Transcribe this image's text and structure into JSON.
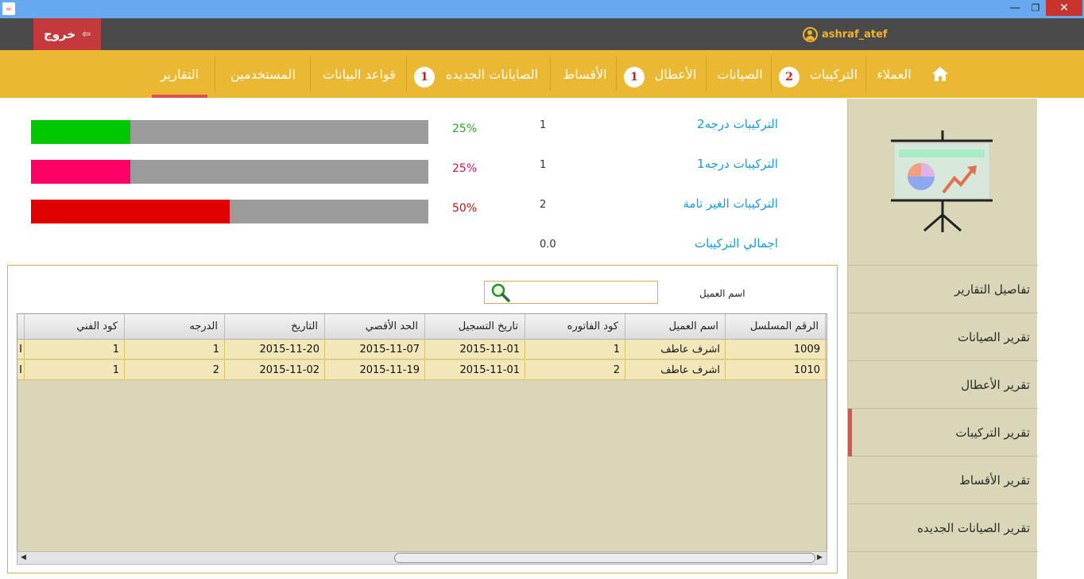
{
  "window": {
    "min_symbol": "—",
    "max_symbol": "❐",
    "close_symbol": "✕",
    "app_icon": "java-icon"
  },
  "header": {
    "logout_label": "خروج",
    "username": "ashraf_atef"
  },
  "nav": {
    "items": [
      {
        "label": "العملاء"
      },
      {
        "label": "التركيبات",
        "badge": "2"
      },
      {
        "label": "الصيانات"
      },
      {
        "label": "الأعطال",
        "badge": "1"
      },
      {
        "label": "الأقساط"
      },
      {
        "label": "الصايانات الجديده",
        "badge": "1"
      },
      {
        "label": "قواعد البيانات"
      },
      {
        "label": "المستخدمين"
      },
      {
        "label": "التقارير"
      }
    ],
    "active": "التقارير"
  },
  "stats": {
    "rows": [
      {
        "label": "التركيبات درجه2",
        "value": "1",
        "percent": "25%",
        "fraction": 0.25,
        "color": "#00c800",
        "pct_color": "#2aa82a"
      },
      {
        "label": "التركيبات درجه1",
        "value": "1",
        "percent": "25%",
        "fraction": 0.25,
        "color": "#ff0066",
        "pct_color": "#d0105a"
      },
      {
        "label": "التركيبات الغير تامة",
        "value": "2",
        "percent": "50%",
        "fraction": 0.5,
        "color": "#e00000",
        "pct_color": "#c01010"
      }
    ],
    "total": {
      "label": "اجمالي التركيبات",
      "value": "0.0"
    }
  },
  "search": {
    "label": "اسم العميل",
    "value": ""
  },
  "table": {
    "columns": [
      "الرقم المسلسل",
      "اسم العميل",
      "كود الفاتوره",
      "تاريخ التسجيل",
      "الحد الأقصي",
      "التاريخ",
      "الدرجه",
      "كود الفني",
      "I"
    ],
    "rows": [
      [
        "1009",
        "اشرف عاطف",
        "1",
        "2015-11-01",
        "2015-11-07",
        "2015-11-20",
        "1",
        "1",
        "I"
      ],
      [
        "1010",
        "اشرف عاطف",
        "2",
        "2015-11-01",
        "2015-11-19",
        "2015-11-02",
        "2",
        "1",
        "I"
      ]
    ]
  },
  "sidebar": {
    "items": [
      {
        "label": "تفاصيل التقارير"
      },
      {
        "label": "تقرير الصيانات"
      },
      {
        "label": "تقرير الأعطال"
      },
      {
        "label": "تقرير التركيبات",
        "active": true
      },
      {
        "label": "تقرير الأقساط"
      },
      {
        "label": "تقرير الصيانات الجديده"
      }
    ]
  }
}
